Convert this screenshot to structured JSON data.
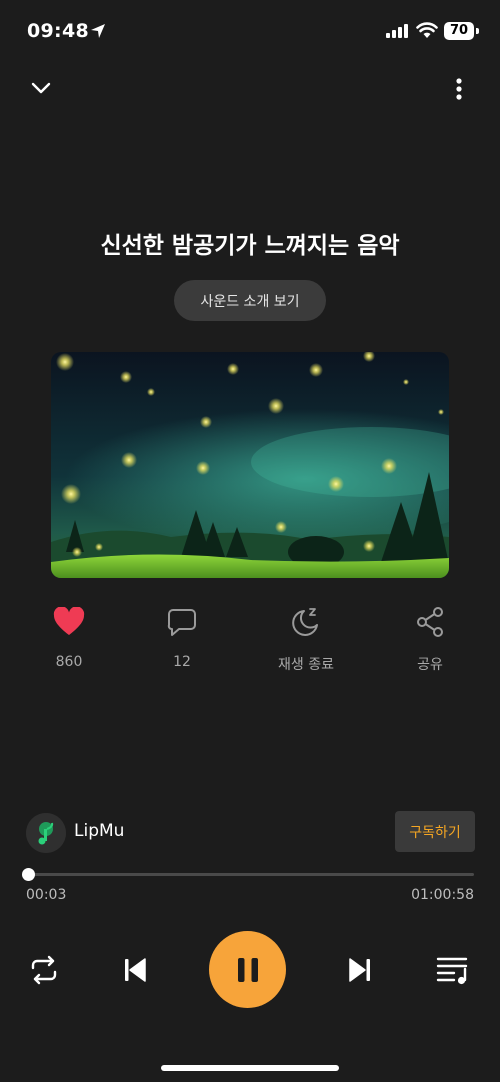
{
  "status_bar": {
    "time": "09:48",
    "battery": "70"
  },
  "player": {
    "title": "신선한 밤공기가 느껴지는 음악",
    "intro_button": "사운드 소개 보기"
  },
  "actions": [
    {
      "name": "like",
      "label": "860",
      "icon": "heart-icon",
      "color": "#ef3b54"
    },
    {
      "name": "comment",
      "label": "12",
      "icon": "comment-icon"
    },
    {
      "name": "sleep-timer",
      "label": "재생 종료",
      "icon": "moon-icon"
    },
    {
      "name": "share",
      "label": "공유",
      "icon": "share-icon"
    }
  ],
  "channel": {
    "name": "LipMu",
    "subscribe_label": "구독하기"
  },
  "progress": {
    "current": "00:03",
    "total": "01:00:58",
    "fraction": 0.0008
  },
  "colors": {
    "accent": "#f7a43a",
    "subscribe_text": "#f5a623",
    "background": "#1c1c1c",
    "like": "#ef3b54"
  }
}
